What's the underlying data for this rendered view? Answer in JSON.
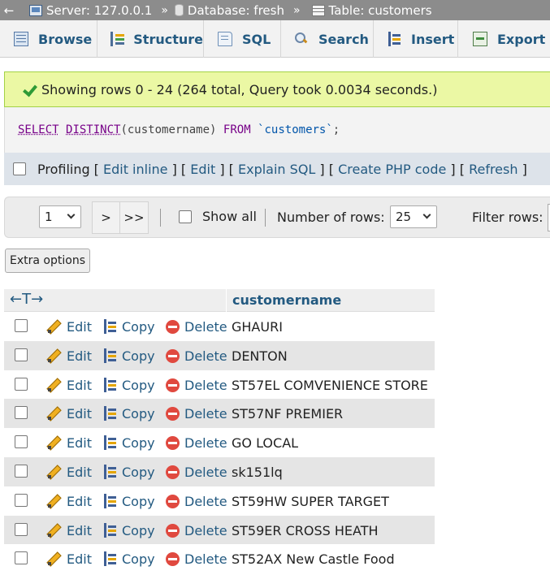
{
  "breadcrumb": {
    "back": "←",
    "server": "Server: 127.0.0.1",
    "database": "Database: fresh",
    "table": "Table: customers",
    "separator": "»"
  },
  "tabs": {
    "browse": "Browse",
    "structure": "Structure",
    "sql": "SQL",
    "search": "Search",
    "insert": "Insert",
    "export": "Export"
  },
  "message": {
    "text": "Showing rows 0 - 24 (264 total, Query took 0.0034 seconds.)"
  },
  "sql": {
    "select": "SELECT",
    "distinct": "DISTINCT",
    "column": "(customername)",
    "from": "FROM",
    "table": "`customers`",
    "end": ";"
  },
  "profiling": {
    "label": "Profiling",
    "edit_inline": "Edit inline",
    "edit": "Edit",
    "explain": "Explain SQL",
    "create_php": "Create PHP code",
    "refresh": "Refresh"
  },
  "navigation": {
    "page_value": "1",
    "next": ">",
    "last": ">>",
    "show_all": "Show all",
    "rows_label": "Number of rows:",
    "rows_value": "25",
    "filter_label": "Filter rows:"
  },
  "extra_options": "Extra options",
  "table": {
    "column": "customername",
    "resize_icon": "←T→",
    "actions": {
      "edit": "Edit",
      "copy": "Copy",
      "delete": "Delete"
    },
    "rows": [
      "GHAURI",
      "DENTON",
      "ST57EL COMVENIENCE STORE",
      "ST57NF PREMIER",
      "GO LOCAL",
      "sk151lq",
      "ST59HW SUPER TARGET",
      "ST59ER CROSS HEATH",
      "ST52AX New Castle Food"
    ]
  },
  "colors": {
    "link": "#235a81",
    "success_bg": "#ebf8a4",
    "delete_icon": "#e0493f"
  }
}
